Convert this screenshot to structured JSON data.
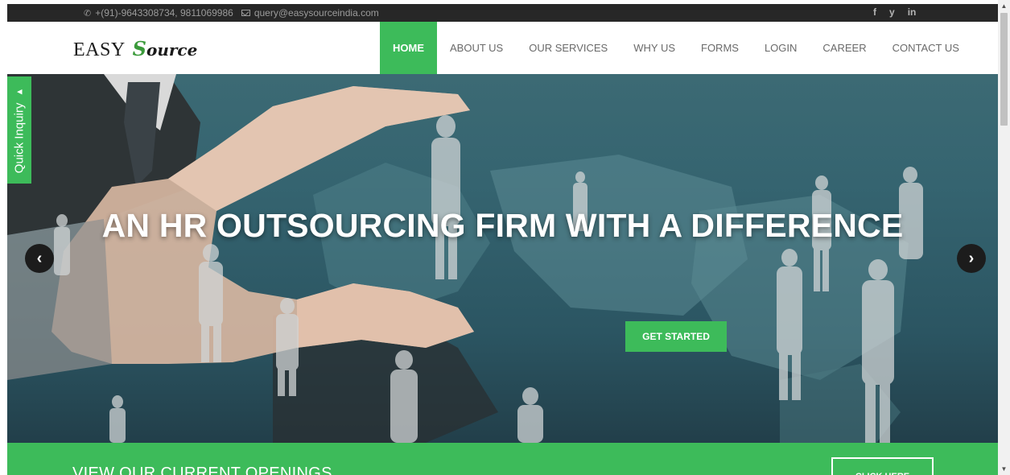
{
  "topbar": {
    "phone": "+(91)-9643308734, 9811069986",
    "email": "query@easysourceindia.com",
    "social": [
      "f",
      "y",
      "in"
    ],
    "icons": [
      "phone-icon",
      "email-icon",
      "facebook-icon",
      "twitter-icon",
      "linkedin-icon"
    ]
  },
  "logo": {
    "main": "EASY",
    "script_first": "S",
    "script_rest": "ource"
  },
  "nav": {
    "items": [
      {
        "label": "HOME",
        "active": true
      },
      {
        "label": "ABOUT US"
      },
      {
        "label": "OUR SERVICES"
      },
      {
        "label": "WHY US"
      },
      {
        "label": "FORMS"
      },
      {
        "label": "LOGIN"
      },
      {
        "label": "CAREER"
      },
      {
        "label": "CONTACT US"
      }
    ]
  },
  "quick_tab": {
    "label": "Quick Inquiry",
    "arrow": "▲"
  },
  "hero": {
    "title": "AN HR OUTSOURCING FIRM WITH A DIFFERENCE",
    "cta": "GET STARTED",
    "prev": "‹",
    "next": "›"
  },
  "openings": {
    "text": "VIEW OUR CURRENT OPENINGS",
    "button": "CLICK HERE"
  },
  "colors": {
    "accent": "#3dbb5a",
    "topbar": "#272727",
    "nav_text": "#6a6a6a"
  }
}
